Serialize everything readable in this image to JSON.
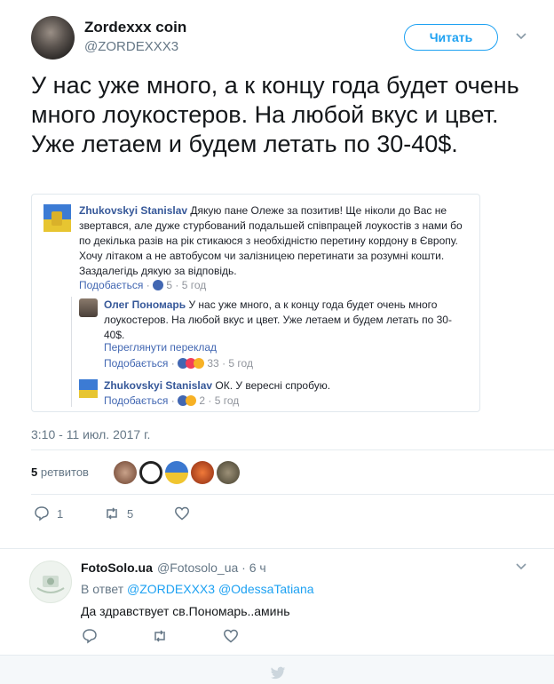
{
  "author": {
    "name": "Zordexxx coin",
    "handle": "@ZORDEXXX3",
    "follow_label": "Читать"
  },
  "tweet": {
    "text": "У нас уже много, а к концу года будет очень много лоукостеров. На любой вкус и цвет. Уже летаем и будем летать по 30-40$.",
    "timestamp": "3:10 - 11 июл. 2017 г.",
    "retweets_count": "5",
    "retweets_label": "ретвитов",
    "replies": "1",
    "retweets": "5"
  },
  "fb_embed": {
    "comments": [
      {
        "name": "Zhukovskyi Stanislav",
        "text": "Дякую пане Олеже за позитив! Ще ніколи до Вас не звертався, але дуже стурбований подальшей співпрацей лоукостів з нами бо по декілька разів на рік стикаюся з необхідністю перетину кордону в Європу. Хочу літаком а не автобусом чи залізницею перетинати за розумні кошти. Заздалегідь дякую за відповідь.",
        "like": "Подобається",
        "count": "5",
        "time": "5 год"
      },
      {
        "name": "Олег Пономарь",
        "text": "У нас уже много, а к концу года будет очень много лоукостеров. На любой вкус и цвет. Уже летаем и будем летать по 30-40$.",
        "see_translation": "Переглянути переклад",
        "like": "Подобається",
        "count": "33",
        "time": "5 год"
      },
      {
        "name": "Zhukovskyi Stanislav",
        "text": "ОК. У вересні спробую.",
        "like": "Подобається",
        "count": "2",
        "time": "5 год"
      }
    ]
  },
  "reply": {
    "name": "FotoSolo.ua",
    "handle": "@Fotosolo_ua",
    "time": "6 ч",
    "in_reply_prefix": "В ответ",
    "mention1": "@ZORDEXXX3",
    "mention2": "@OdessaTatiana",
    "text": "Да здравствует св.Пономарь..аминь"
  },
  "colors": {
    "accent": "#1da1f2",
    "fb_name": "#365899",
    "muted": "#657786"
  }
}
